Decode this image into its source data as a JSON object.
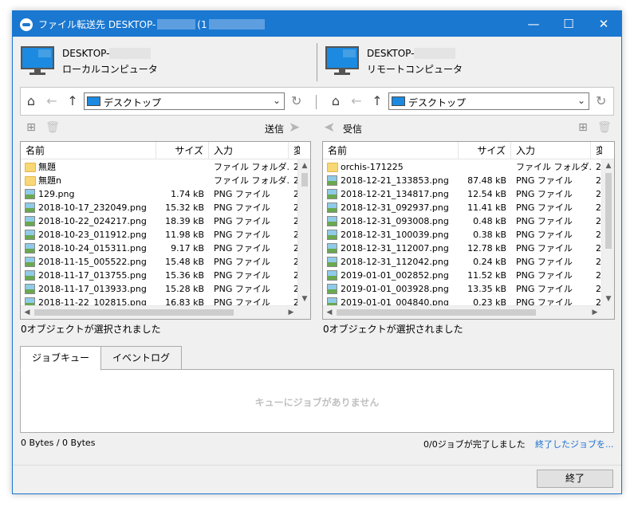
{
  "window": {
    "title_prefix": "ファイル転送先 DESKTOP-",
    "title_paren": "(1",
    "controls": {
      "minimize": "—",
      "maximize": "☐",
      "close": "✕"
    }
  },
  "local": {
    "host_prefix": "DESKTOP-",
    "host_type": "ローカルコンピュータ",
    "location": "デスクトップ",
    "action_label": "送信",
    "columns": [
      "名前",
      "サイズ",
      "入力",
      "変"
    ],
    "files": [
      {
        "name": "無題",
        "size": "",
        "type": "ファイル フォルダ...",
        "extra": "2",
        "icon": "folder"
      },
      {
        "name": "無題n",
        "size": "",
        "type": "ファイル フォルダ...",
        "extra": "2",
        "icon": "folder"
      },
      {
        "name": "129.png",
        "size": "1.74 kB",
        "type": "PNG ファイル",
        "extra": "2",
        "icon": "png"
      },
      {
        "name": "2018-10-17_232049.png",
        "size": "15.32 kB",
        "type": "PNG ファイル",
        "extra": "2",
        "icon": "png"
      },
      {
        "name": "2018-10-22_024217.png",
        "size": "18.39 kB",
        "type": "PNG ファイル",
        "extra": "2",
        "icon": "png"
      },
      {
        "name": "2018-10-23_011912.png",
        "size": "11.98 kB",
        "type": "PNG ファイル",
        "extra": "2",
        "icon": "png"
      },
      {
        "name": "2018-10-24_015311.png",
        "size": "9.17 kB",
        "type": "PNG ファイル",
        "extra": "2",
        "icon": "png"
      },
      {
        "name": "2018-11-15_005522.png",
        "size": "15.48 kB",
        "type": "PNG ファイル",
        "extra": "2",
        "icon": "png"
      },
      {
        "name": "2018-11-17_013755.png",
        "size": "15.36 kB",
        "type": "PNG ファイル",
        "extra": "2",
        "icon": "png"
      },
      {
        "name": "2018-11-17_013933.png",
        "size": "15.28 kB",
        "type": "PNG ファイル",
        "extra": "2",
        "icon": "png"
      },
      {
        "name": "2018-11-22_102815.png",
        "size": "16.83 kB",
        "type": "PNG ファイル",
        "extra": "2",
        "icon": "png"
      }
    ],
    "selection_status": "0オブジェクトが選択されました"
  },
  "remote": {
    "host_prefix": "DESKTOP-",
    "host_type": "リモートコンピュータ",
    "location": "デスクトップ",
    "action_label": "受信",
    "columns": [
      "名前",
      "サイズ",
      "入力",
      "変"
    ],
    "files": [
      {
        "name": "orchis-171225",
        "size": "",
        "type": "ファイル フォルダ...",
        "extra": "2",
        "icon": "folder"
      },
      {
        "name": "2018-12-21_133853.png",
        "size": "87.48 kB",
        "type": "PNG ファイル",
        "extra": "2",
        "icon": "png"
      },
      {
        "name": "2018-12-21_134817.png",
        "size": "12.54 kB",
        "type": "PNG ファイル",
        "extra": "2",
        "icon": "png"
      },
      {
        "name": "2018-12-31_092937.png",
        "size": "11.41 kB",
        "type": "PNG ファイル",
        "extra": "2",
        "icon": "png"
      },
      {
        "name": "2018-12-31_093008.png",
        "size": "0.48 kB",
        "type": "PNG ファイル",
        "extra": "2",
        "icon": "png"
      },
      {
        "name": "2018-12-31_100039.png",
        "size": "0.38 kB",
        "type": "PNG ファイル",
        "extra": "2",
        "icon": "png"
      },
      {
        "name": "2018-12-31_112007.png",
        "size": "12.78 kB",
        "type": "PNG ファイル",
        "extra": "2",
        "icon": "png"
      },
      {
        "name": "2018-12-31_112042.png",
        "size": "0.24 kB",
        "type": "PNG ファイル",
        "extra": "2",
        "icon": "png"
      },
      {
        "name": "2019-01-01_002852.png",
        "size": "11.52 kB",
        "type": "PNG ファイル",
        "extra": "2",
        "icon": "png"
      },
      {
        "name": "2019-01-01_003928.png",
        "size": "13.35 kB",
        "type": "PNG ファイル",
        "extra": "2",
        "icon": "png"
      },
      {
        "name": "2019-01-01_004840.png",
        "size": "0.23 kB",
        "type": "PNG ファイル",
        "extra": "2",
        "icon": "png"
      }
    ],
    "selection_status": "0オブジェクトが選択されました"
  },
  "jobs": {
    "tabs": [
      "ジョブキュー",
      "イベントログ"
    ],
    "active_tab": 0,
    "empty_message": "キューにジョブがありません",
    "bytes": "0 Bytes / 0 Bytes",
    "completed": "0/0ジョブが完了しました",
    "clear_link": "終了したジョブを..."
  },
  "footer": {
    "close_label": "終了"
  },
  "colors": {
    "titlebar": "#1a78d0",
    "link": "#1a6fd0",
    "monitor": "#1c8ae0"
  },
  "icons": {
    "home": "home-icon",
    "back": "back-arrow-icon",
    "up": "up-arrow-icon",
    "refresh": "refresh-icon",
    "new_folder": "new-folder-icon",
    "delete": "trash-icon",
    "send": "send-arrow-icon",
    "receive": "receive-arrow-icon"
  }
}
